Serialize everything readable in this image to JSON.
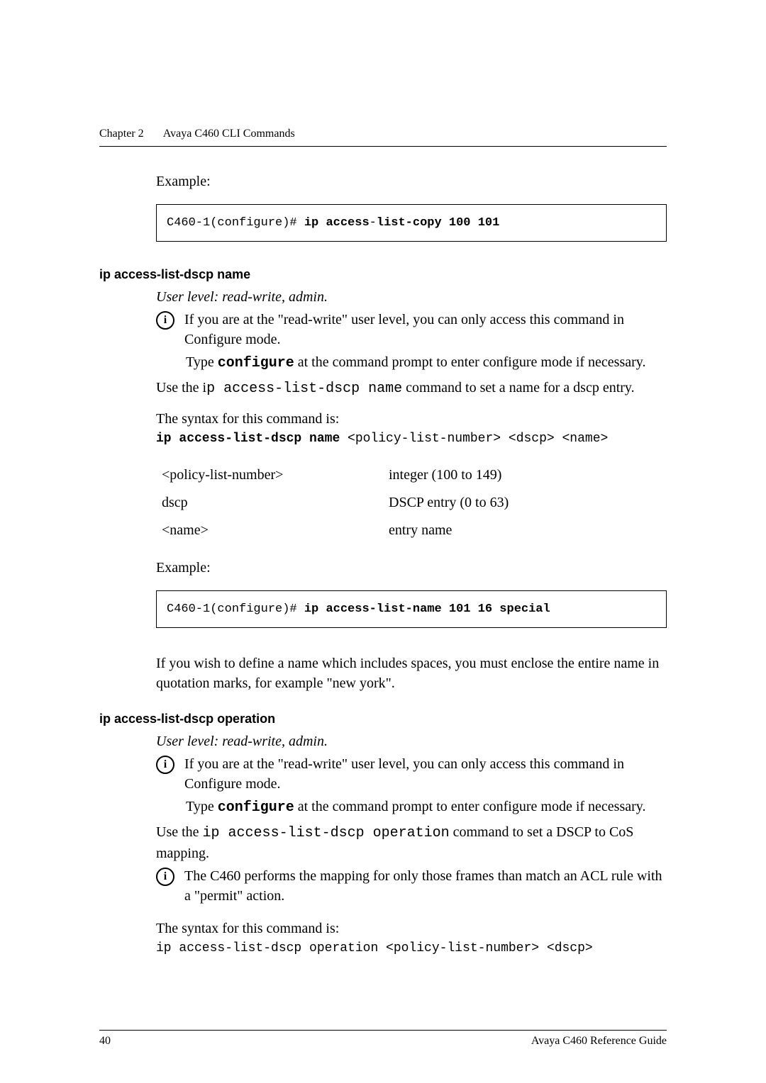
{
  "header": {
    "chapter": "Chapter 2",
    "chapter_title": "Avaya C460 CLI Commands"
  },
  "top": {
    "example_label": "Example:",
    "code_prompt": "C460-1(configure)# ",
    "code_cmd_bold1": "ip access",
    "code_cmd_plain": "-",
    "code_cmd_bold2": "list-copy 100 101"
  },
  "section1": {
    "title": "ip access-list-dscp name",
    "userlevel": "User level: read-write, admin.",
    "note1_main": "If you are at the \"read-write\" user level, you can only access this command in Configure mode.",
    "note1_sub_before": "Type ",
    "note1_sub_cmd": "configure",
    "note1_sub_after": " at the command prompt to enter configure mode if necessary.",
    "use_before": "Use the i",
    "use_mono": "p access-list-dscp name",
    "use_after": " command to set a name for a dscp entry.",
    "syntax_label": "The syntax for this command is:",
    "syntax_bold": "ip access-list-dscp name",
    "syntax_args": " <policy-list-number> <dscp> <name>",
    "params": [
      {
        "k": "<policy-list-number>",
        "v": "integer (100 to 149)"
      },
      {
        "k": "dscp",
        "v": "DSCP entry (0 to 63)"
      },
      {
        "k": "<name>",
        "v": "entry name"
      }
    ],
    "example_label": "Example:",
    "code_prompt": "C460-1(configure)# ",
    "code_cmd": "ip access-list-name 101 16 special",
    "trail1": "If you wish to define a name which includes spaces, you must enclose the entire name in quotation marks, for example \"new york\"."
  },
  "section2": {
    "title": "ip access-list-dscp operation",
    "userlevel": "User level: read-write, admin.",
    "note1_main": "If you are at the \"read-write\" user level, you can only access this command in Configure mode.",
    "note1_sub_before": "Type ",
    "note1_sub_cmd": "configure",
    "note1_sub_after": " at the command prompt to enter configure mode if necessary.",
    "use_before": "Use the ",
    "use_mono": "ip access-list-dscp operation",
    "use_after": " command to set a DSCP to CoS mapping.",
    "note2": "The C460 performs the mapping for only those frames than match an ACL rule with a \"permit\" action.",
    "syntax_label": "The syntax for this command is:",
    "syntax_line": "ip access-list-dscp operation <policy-list-number> <dscp>"
  },
  "footer": {
    "page_number": "40",
    "doc_title": "Avaya C460 Reference Guide"
  }
}
